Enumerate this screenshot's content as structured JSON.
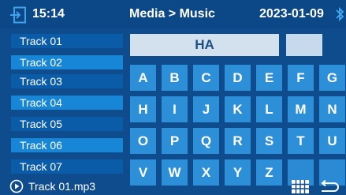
{
  "header": {
    "time": "15:14",
    "title": "Media > Music",
    "date": "2023-01-09",
    "icons": {
      "exit": "exit-icon",
      "bluetooth": "bluetooth-icon"
    }
  },
  "tracks": [
    "Track 01",
    "Track 02",
    "Track 03",
    "Track 04",
    "Track 05",
    "Track 06",
    "Track 07"
  ],
  "search": {
    "value": "HA"
  },
  "keyboard": {
    "rows": [
      [
        "A",
        "B",
        "C",
        "D",
        "E",
        "F",
        "G"
      ],
      [
        "H",
        "I",
        "J",
        "K",
        "L",
        "M",
        "N"
      ],
      [
        "O",
        "P",
        "Q",
        "R",
        "S",
        "T",
        "U"
      ],
      [
        "V",
        "W",
        "X",
        "Y",
        "Z",
        "",
        ""
      ]
    ]
  },
  "footer": {
    "now_playing": "Track 01.mp3",
    "icons": {
      "play": "play-icon",
      "grid": "keyboard-grid-icon",
      "back": "back-icon"
    }
  },
  "colors": {
    "background": "#0f4c8e",
    "track_dark": "#0a5ca9",
    "track_light": "#1786d6",
    "key": "#2d8fd7",
    "input": "#d3e1ef"
  }
}
